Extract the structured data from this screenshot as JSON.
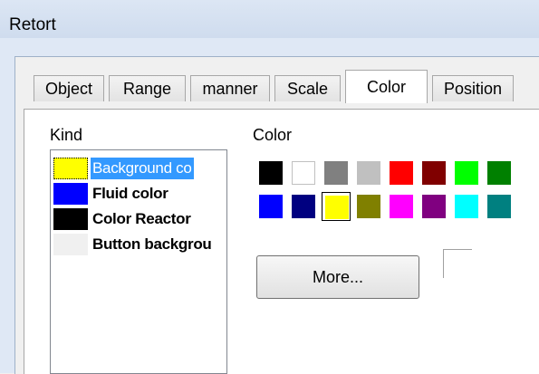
{
  "window": {
    "title": "Retort"
  },
  "tabs": [
    {
      "label": "Object"
    },
    {
      "label": "Range"
    },
    {
      "label": "manner"
    },
    {
      "label": "Scale"
    },
    {
      "label": "Color",
      "active": true
    },
    {
      "label": "Position"
    }
  ],
  "kind": {
    "label": "Kind",
    "items": [
      {
        "label": "Background co",
        "swatch": "#ffff00",
        "selected": true
      },
      {
        "label": "Fluid color",
        "swatch": "#0000ff"
      },
      {
        "label": "Color Reactor",
        "swatch": "#000000"
      },
      {
        "label": "Button backgrou",
        "swatch": "#f0f0f0"
      }
    ]
  },
  "color": {
    "label": "Color",
    "palette_row1": [
      "#000000",
      "#ffffff",
      "#808080",
      "#c0c0c0",
      "#ff0000",
      "#800000",
      "#00ff00",
      "#008000"
    ],
    "palette_row2": [
      "#0000ff",
      "#000080",
      "#ffff00",
      "#808000",
      "#ff00ff",
      "#800080",
      "#00ffff",
      "#008080"
    ],
    "selected": "#ffff00",
    "more_label": "More..."
  }
}
